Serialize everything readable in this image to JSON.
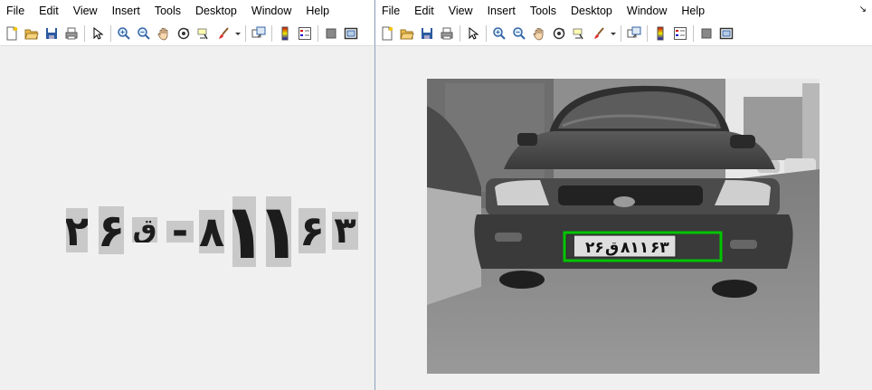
{
  "menu": [
    "File",
    "Edit",
    "View",
    "Insert",
    "Tools",
    "Desktop",
    "Window",
    "Help"
  ],
  "dock_arrow": "↘",
  "toolbar_icons": [
    "new-figure-icon",
    "open-file-icon",
    "save-icon",
    "print-icon",
    "pointer-icon",
    "zoom-in-icon",
    "zoom-out-icon",
    "pan-icon",
    "rotate-3d-icon",
    "data-cursor-icon",
    "brush-icon",
    "link-plot-icon",
    "colorbar-icon",
    "legend-icon",
    "hide-plot-tools-icon",
    "show-plot-tools-icon"
  ],
  "segmented_chars": [
    "۲",
    "۶",
    "ق",
    "-",
    "۸",
    "۱",
    "۱",
    "۶",
    "۳"
  ],
  "plate": {
    "left_text": "۲۶",
    "letter": "ق",
    "middle_text": "۸۱۱",
    "right_text": "۶۳",
    "box_color": "#00c400"
  }
}
